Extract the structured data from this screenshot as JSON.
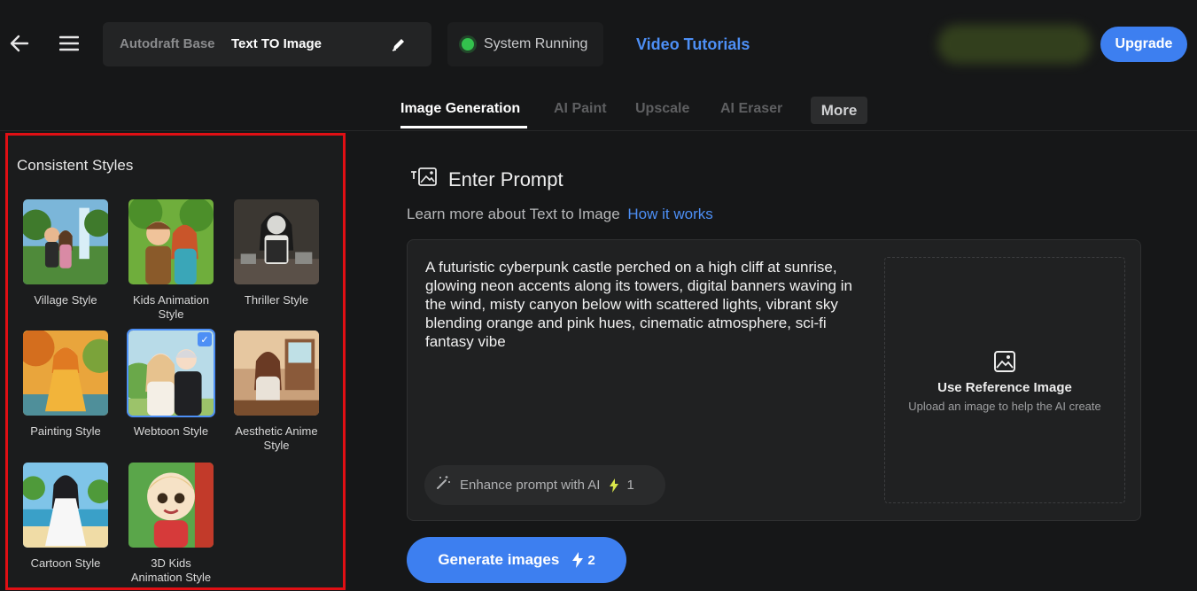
{
  "header": {
    "breadcrumb_base": "Autodraft Base",
    "breadcrumb_current": "Text TO Image",
    "status_text": "System Running",
    "tutorials_label": "Video Tutorials",
    "upgrade_label": "Upgrade"
  },
  "tabs": [
    {
      "label": "Image Generation",
      "active": true
    },
    {
      "label": "AI Paint",
      "active": false
    },
    {
      "label": "Upscale",
      "active": false
    },
    {
      "label": "AI Eraser",
      "active": false
    },
    {
      "label": "More",
      "active": false
    }
  ],
  "styles_panel": {
    "title": "Consistent Styles",
    "items": [
      {
        "label": "Village Style",
        "selected": false
      },
      {
        "label": "Kids Animation Style",
        "selected": false
      },
      {
        "label": "Thriller Style",
        "selected": false
      },
      {
        "label": "Painting Style",
        "selected": false
      },
      {
        "label": "Webtoon Style",
        "selected": true
      },
      {
        "label": "Aesthetic Anime Style",
        "selected": false
      },
      {
        "label": "Cartoon Style",
        "selected": false
      },
      {
        "label": "3D Kids Animation Style",
        "selected": false
      }
    ],
    "check_mark": "✓"
  },
  "prompt": {
    "heading": "Enter Prompt",
    "learn_text": "Learn more about Text to Image",
    "learn_link": "How it works",
    "text": "A futuristic cyberpunk castle perched on a high cliff at sunrise, glowing neon accents along its towers, digital banners waving in the wind, misty canyon below with scattered lights, vibrant sky blending orange and pink hues, cinematic atmosphere, sci-fi fantasy vibe",
    "enhance_label": "Enhance prompt with AI",
    "enhance_cost": "1",
    "reference_title": "Use Reference Image",
    "reference_subtitle": "Upload an image to help the AI create"
  },
  "generate": {
    "label": "Generate images",
    "cost": "2"
  },
  "colors": {
    "accent": "#3d7ff0",
    "link": "#4d8ff5",
    "status_ok": "#33c24d",
    "highlight_border": "#e00f14"
  }
}
